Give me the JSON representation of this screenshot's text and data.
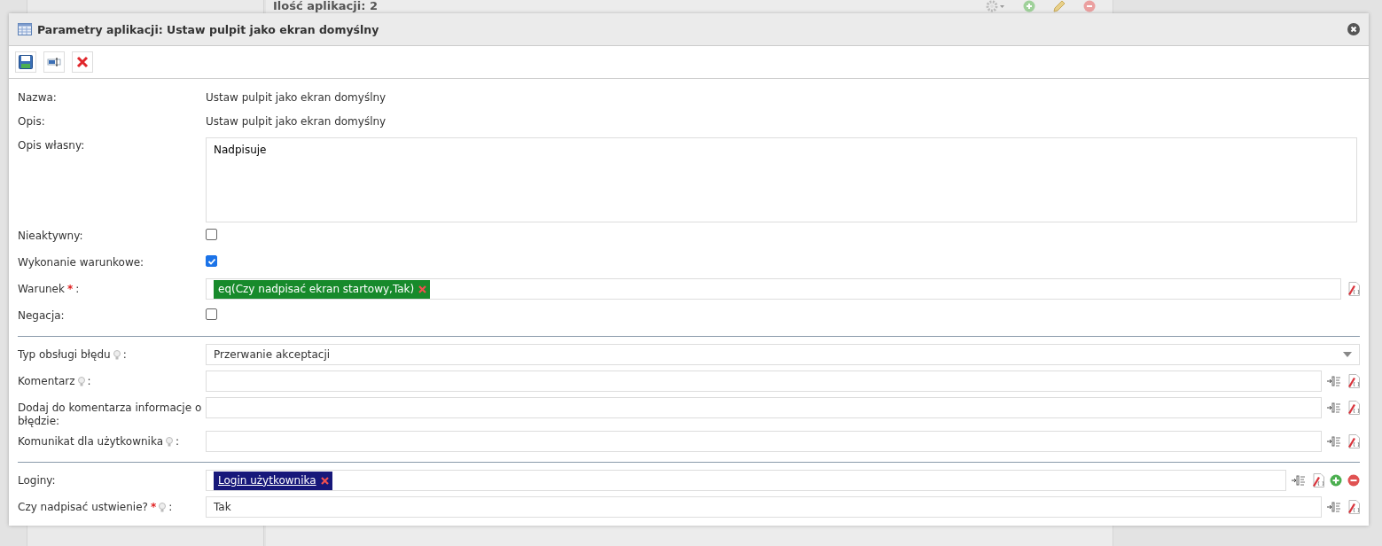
{
  "background": {
    "heading": "Ilość aplikacji: 2",
    "toolbar": [
      {
        "kind": "settings"
      },
      {
        "kind": "add"
      },
      {
        "kind": "edit"
      },
      {
        "kind": "remove"
      }
    ]
  },
  "dialog": {
    "title": "Parametry aplikacji: Ustaw pulpit jako ekran domyślny",
    "toolbar": [
      {
        "kind": "save"
      },
      {
        "kind": "field"
      },
      {
        "kind": "cancel"
      }
    ],
    "sections": [
      {
        "fields": [
          {
            "kind": "text",
            "label": "Nazwa:",
            "value": "Ustaw pulpit jako ekran domyślny"
          },
          {
            "kind": "text",
            "label": "Opis:",
            "value": "Ustaw pulpit jako ekran domyślny"
          },
          {
            "kind": "textarea",
            "label": "Opis własny:",
            "value": "Nadpisuje"
          },
          {
            "kind": "checkbox",
            "label": "Nieaktywny:",
            "checked": false
          },
          {
            "kind": "checkbox",
            "label": "Wykonanie warunkowe:",
            "checked": true
          },
          {
            "kind": "tags",
            "label": "Warunek",
            "required": "*",
            "colon": ":",
            "tags": [
              {
                "text": "eq(Czy nadpisać ekran startowy,Tak)",
                "color": "#178a2b",
                "link": false
              }
            ],
            "actions": [
              {
                "kind": "formula"
              }
            ]
          },
          {
            "kind": "checkbox",
            "label": "Negacja:",
            "checked": false
          }
        ]
      },
      {
        "fields": [
          {
            "kind": "select",
            "label": "Typ obsługi błędu",
            "hint": true,
            "colon": ":",
            "value": "Przerwanie akceptacji"
          },
          {
            "kind": "input",
            "label": "Komentarz",
            "hint": true,
            "colon": ":",
            "actions": [
              {
                "kind": "insert"
              },
              {
                "kind": "formula"
              }
            ]
          },
          {
            "kind": "input",
            "label": "Dodaj do komentarza informacje o błędzie:",
            "actions": [
              {
                "kind": "insert"
              },
              {
                "kind": "formula"
              }
            ]
          },
          {
            "kind": "input",
            "label": "Komunikat dla użytkownika",
            "hint": true,
            "colon": ":",
            "actions": [
              {
                "kind": "insert"
              },
              {
                "kind": "formula"
              }
            ]
          }
        ]
      },
      {
        "fields": [
          {
            "kind": "tags",
            "label": "Loginy:",
            "tags": [
              {
                "text": "Login użytkownika",
                "color": "#17187a",
                "link": true
              }
            ],
            "actions": [
              {
                "kind": "insert"
              },
              {
                "kind": "formula"
              },
              {
                "kind": "add"
              },
              {
                "kind": "remove"
              }
            ]
          },
          {
            "kind": "input",
            "label": "Czy nadpisać ustwienie?",
            "required": "*",
            "hint": true,
            "colon": ":",
            "value": "Tak",
            "actions": [
              {
                "kind": "insert"
              },
              {
                "kind": "formula"
              }
            ]
          }
        ]
      }
    ]
  }
}
